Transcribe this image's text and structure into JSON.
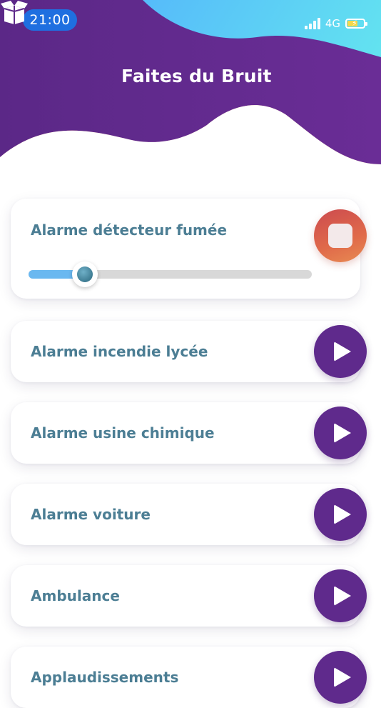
{
  "status_bar": {
    "time": "21:00",
    "network": "4G",
    "battery_level": 0.65,
    "signal_bars": 4
  },
  "header": {
    "title": "Faites du Bruit",
    "app_icon": "open-box-icon"
  },
  "sounds": [
    {
      "label": "Alarme détecteur fumée",
      "state": "playing",
      "control_icon": "stop-icon",
      "progress": 0.2
    },
    {
      "label": "Alarme incendie lycée",
      "state": "idle",
      "control_icon": "play-icon"
    },
    {
      "label": "Alarme usine chimique",
      "state": "idle",
      "control_icon": "play-icon"
    },
    {
      "label": "Alarme voiture",
      "state": "idle",
      "control_icon": "play-icon"
    },
    {
      "label": "Ambulance",
      "state": "idle",
      "control_icon": "play-icon"
    },
    {
      "label": "Applaudissements",
      "state": "idle",
      "control_icon": "play-icon"
    }
  ],
  "colors": {
    "header_purple": "#5e2a8a",
    "accent_orange": "#ef8a52",
    "accent_pink": "#d05a7a",
    "sky_blue": "#5fd0f2",
    "play_button": "#5f2a8c",
    "stop_button": "#e06a4a",
    "label_text": "#4c7e94",
    "slider_fill": "#6ab8f0"
  }
}
